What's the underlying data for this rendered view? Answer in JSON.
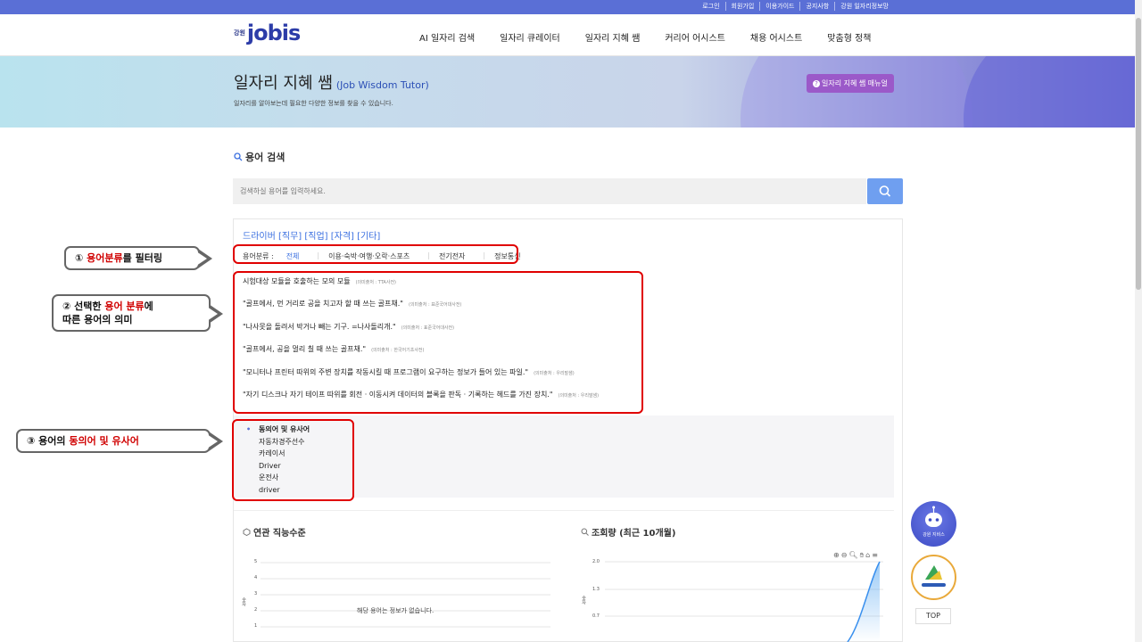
{
  "topbar": {
    "links": [
      "로그인",
      "회원가입",
      "이용가이드",
      "공지사항",
      "강원 일자리정보망"
    ]
  },
  "header": {
    "logo_small": "강원",
    "logo_main": "jobis",
    "nav": [
      "AI 일자리 검색",
      "일자리 큐레이터",
      "일자리 지혜 쌤",
      "커리어 어시스트",
      "채용 어시스트",
      "맞춤형 정책"
    ]
  },
  "banner": {
    "title": "일자리 지혜 쌤",
    "title_en": "(Job Wisdom Tutor)",
    "subtitle": "일자리를 알아보는데 필요한 다양한 정보를 찾을 수 있습니다.",
    "manual_button": "일자리 지혜 쌤 매뉴얼"
  },
  "search": {
    "section_title": "용어 검색",
    "placeholder": "검색하실 용어를 입력하세요."
  },
  "term": {
    "title": "드라이버 [직무] [직업] [자격] [기타]",
    "filter_label": "용어분류 :",
    "filters": [
      "전체",
      "이용·숙박·여행·오락·스포츠",
      "전기전자",
      "정보통신"
    ],
    "meanings": [
      {
        "text": "시험대상 모듈을 호출하는 모의 모듈",
        "source": "(의미출처 : TTA사전)"
      },
      {
        "text": "\"골프에서, 먼 거리로 공을 치고자 할 때 쓰는 골프채.\"",
        "source": "(의미출처 : 표준국어대사전)"
      },
      {
        "text": "\"나사못을 돌려서 박거나 빼는 기구. =나사돌리개.\"",
        "source": "(의미출처 : 표준국어대사전)"
      },
      {
        "text": "\"골프에서, 공을 멀리 칠 때 쓰는 골프채.\"",
        "source": "(의미출처 : 한국어기초사전)"
      },
      {
        "text": "\"모니터나 프린터 따위의 주변 장치를 작동시킬 때 프로그램이 요구하는 정보가 들어 있는 파일.\"",
        "source": "(의미출처 : 우리말샘)"
      },
      {
        "text": "\"자기 디스크나 자기 테이프 따위를 회전 · 이동시켜 데이터의 블록을 판독 · 기록하는 헤드를 가진 장치.\"",
        "source": "(의미출처 : 우리말샘)"
      }
    ],
    "synonyms_title": "동의어 및 유사어",
    "synonyms": [
      "자동차경주선수",
      "카레이서",
      "Driver",
      "운전사",
      "driver"
    ]
  },
  "callouts": {
    "c1_pre": "① ",
    "c1_hl": "용어분류",
    "c1_post": "를 필터링",
    "c2_pre": "② 선택한 ",
    "c2_hl": "용어 분류",
    "c2_post": "에",
    "c2_line2": "따른 용어의 의미",
    "c3_pre": "③ 용어의 ",
    "c3_hl": "동의어 및 유사어"
  },
  "charts": {
    "left_title": "연관 직능수준",
    "left_yaxis": [
      "5",
      "4",
      "3",
      "2",
      "1"
    ],
    "left_ylabel": "숫자",
    "nodata": "해당 용어는 정보가 없습니다.",
    "right_title": "조회량 (최근 10개월)",
    "right_yaxis": [
      "2.0",
      "1.3",
      "0.7"
    ],
    "right_ylabel": "숫자"
  },
  "floating": {
    "assist_label": "강원 지비스",
    "top_label": "TOP"
  },
  "colors": {
    "accent": "#5a6fd6",
    "highlight": "#e00000",
    "link": "#3a6fe0"
  }
}
